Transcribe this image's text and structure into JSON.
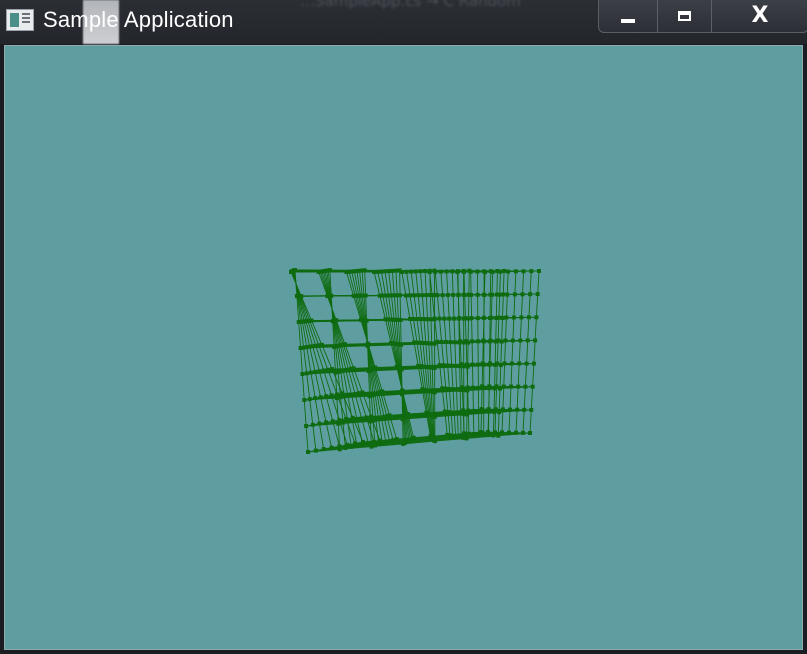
{
  "window": {
    "title": "Sample Application",
    "background_text": "…SampleApp.cs  →  C  Random",
    "icon": "app-window-icon",
    "controls": {
      "minimize_icon": "minimize-icon",
      "maximize_icon": "maximize-icon",
      "close_label": "X"
    }
  },
  "viewport": {
    "background_color": "#5f9ea0",
    "mesh_color": "#0f6b10",
    "content": "wireframe-lattice-cube"
  }
}
